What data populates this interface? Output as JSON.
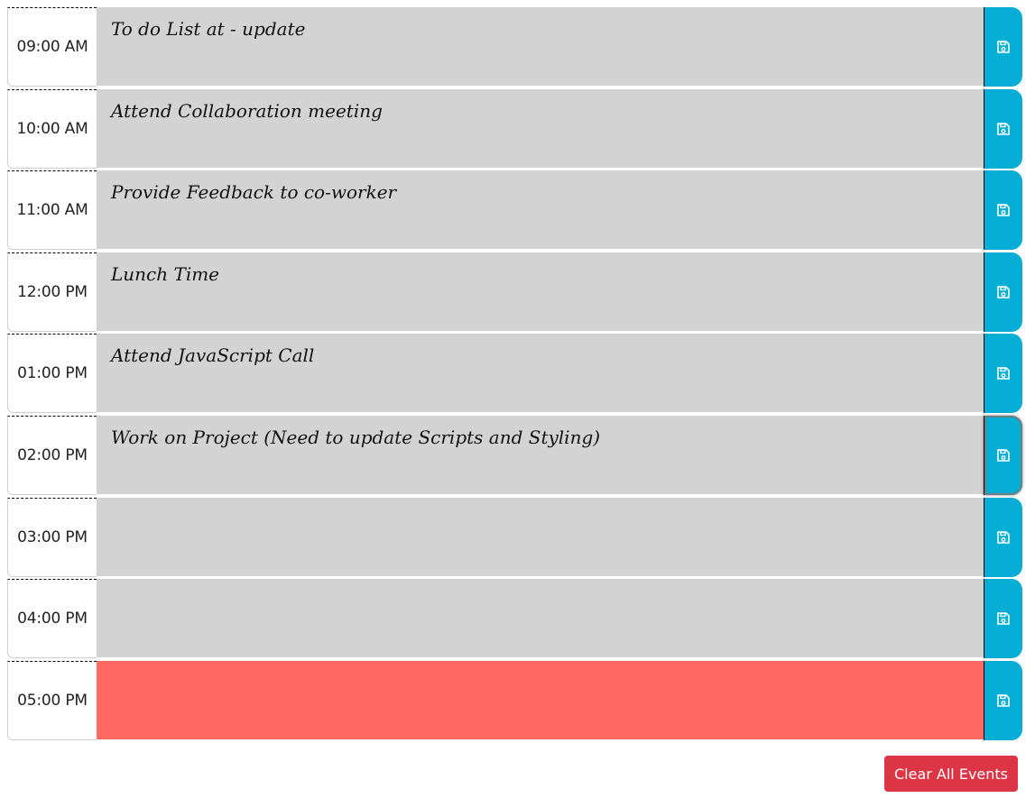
{
  "planner": {
    "rows": [
      {
        "time": "09:00 AM",
        "event": "To do List at - update",
        "state": "past"
      },
      {
        "time": "10:00 AM",
        "event": "Attend Collaboration meeting",
        "state": "past"
      },
      {
        "time": "11:00 AM",
        "event": "Provide Feedback to co-worker",
        "state": "past"
      },
      {
        "time": "12:00 PM",
        "event": "Lunch Time",
        "state": "past"
      },
      {
        "time": "01:00 PM",
        "event": "Attend JavaScript Call",
        "state": "past"
      },
      {
        "time": "02:00 PM",
        "event": "Work on Project (Need to update Scripts and Styling)",
        "state": "past"
      },
      {
        "time": "03:00 PM",
        "event": "",
        "state": "past"
      },
      {
        "time": "04:00 PM",
        "event": "",
        "state": "past"
      },
      {
        "time": "05:00 PM",
        "event": "",
        "state": "present"
      }
    ],
    "save_icon": "floppy-disk-icon"
  },
  "actions": {
    "clear_label": "Clear All Events"
  },
  "colors": {
    "past": "#d3d3d3",
    "present": "#ff6961",
    "save": "#06aed5",
    "danger": "#dc3545"
  }
}
